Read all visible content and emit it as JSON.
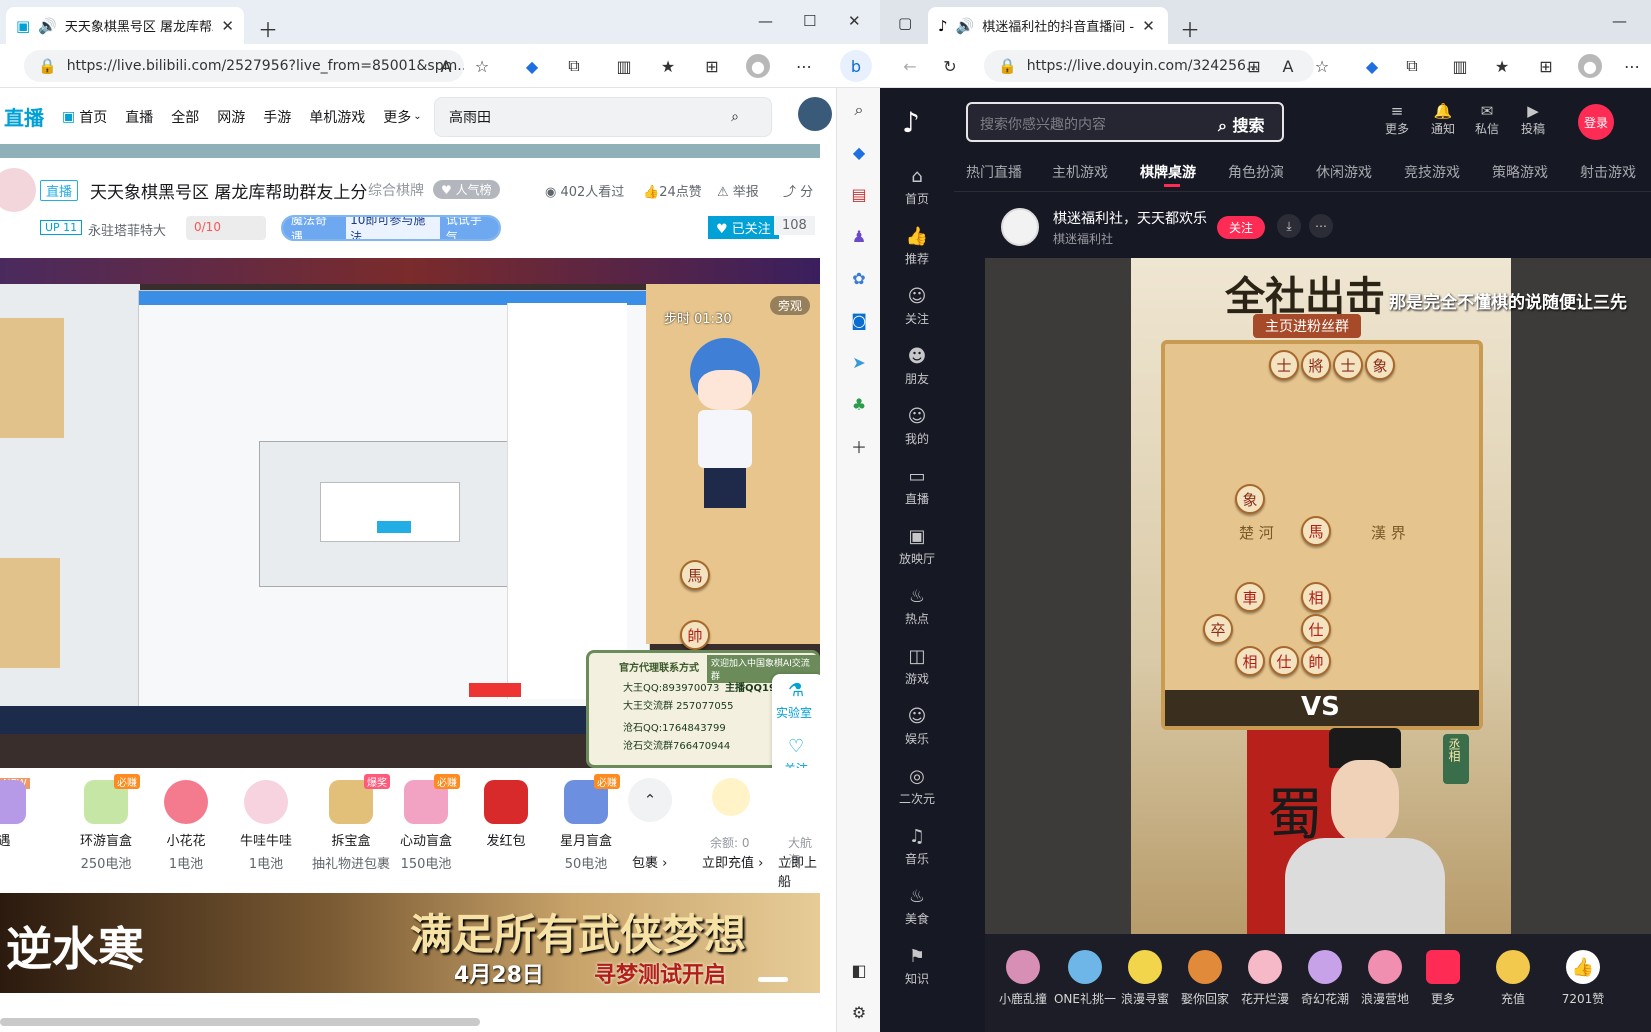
{
  "left_browser": {
    "tab_title": "天天象棋黑号区 屠龙库帮助",
    "url": "https://live.bilibili.com/2527956?live_from=85001&spm...",
    "nav": {
      "logo": "直播",
      "items": [
        "首页",
        "直播",
        "全部",
        "网游",
        "手游",
        "单机游戏",
        "更多"
      ],
      "search_placeholder": "高雨田"
    },
    "room": {
      "live_tag": "直播",
      "title": "天天象棋黑号区 屠龙库帮助群友上分",
      "category": "综合棋牌",
      "popularity_label": "人气榜",
      "viewers": "402人看过",
      "likes": "24点赞",
      "report": "举报",
      "share": "分",
      "up_level": "UP 11",
      "streamer": "永驻塔菲特大",
      "fan_count": "0/10",
      "event_name": "魔法奇遇",
      "event_desc": "10即可参与施法",
      "event_btn": "试试手气",
      "follow_label": "已关注",
      "follower_count": "108"
    },
    "overlay": {
      "qq_title": "官方代理联系方式",
      "qq1": "大王QQ:893970073",
      "qq2": "大王交流群 257077055",
      "qq3": "沧石QQ:1764843799",
      "qq4": "沧石交流群766470944",
      "welcome": "欢迎加入中国象棋AI交流群",
      "host_qq": "主播QQ19",
      "side_lab": "实验室",
      "side_follow": "关注",
      "game_timer": "步时 01:30",
      "spectate": "旁观"
    },
    "gifts": [
      {
        "name": "遇",
        "sub": ""
      },
      {
        "name": "环游盲盒",
        "sub": "250电池",
        "badge": "必赚"
      },
      {
        "name": "小花花",
        "sub": "1电池"
      },
      {
        "name": "牛哇牛哇",
        "sub": "1电池"
      },
      {
        "name": "拆宝盒",
        "sub": "抽礼物进包裹",
        "badge": "爆奖"
      },
      {
        "name": "心动盲盒",
        "sub": "150电池",
        "badge": "必赚"
      },
      {
        "name": "发红包",
        "sub": ""
      },
      {
        "name": "星月盲盒",
        "sub": "50电池",
        "badge": "必赚"
      }
    ],
    "gift_pack": "包裹",
    "balance": "余额: 0",
    "recharge": "立即充值",
    "captain": "大航海",
    "captain_sub": "立即上船",
    "new_badge": "NEW",
    "ad": {
      "slogan": "满足所有武侠梦想",
      "date": "4月28日",
      "sub": "寻梦测试开启",
      "game": "逆水寒"
    }
  },
  "right_browser": {
    "tab_title": "棋迷福利社的抖音直播间 - ",
    "url": "https://live.douyin.com/324256...",
    "search_placeholder": "搜索你感兴趣的内容",
    "search_btn": "搜索",
    "header_actions": [
      "更多",
      "通知",
      "私信",
      "投稿"
    ],
    "login": "登录",
    "sidebar": [
      "首页",
      "推荐",
      "关注",
      "朋友",
      "我的",
      "直播",
      "放映厅",
      "热点",
      "游戏",
      "娱乐",
      "二次元",
      "音乐",
      "美食",
      "知识"
    ],
    "categories": [
      "热门直播",
      "主机游戏",
      "棋牌桌游",
      "角色扮演",
      "休闲游戏",
      "竞技游戏",
      "策略游戏",
      "射击游戏"
    ],
    "active_category": "棋牌桌游",
    "room_title": "棋迷福利社，天天都欢乐",
    "room_host": "棋迷福利社",
    "follow_btn": "关注",
    "video": {
      "headline": "全社出击",
      "sub": "主页进粉丝群",
      "caption": "那是完全不懂棋的说随便让三先",
      "river_left": "楚 河",
      "river_right": "漢 界",
      "vs": "VS",
      "shu": "蜀",
      "side_text": "丞相"
    },
    "gifts": [
      "小鹿乱撞",
      "ONE礼挑一",
      "浪漫寻蜜",
      "娶你回家",
      "花开烂漫",
      "奇幻花潮",
      "浪漫营地",
      "更多"
    ],
    "recharge": "充值",
    "like_count": "7201赞"
  }
}
